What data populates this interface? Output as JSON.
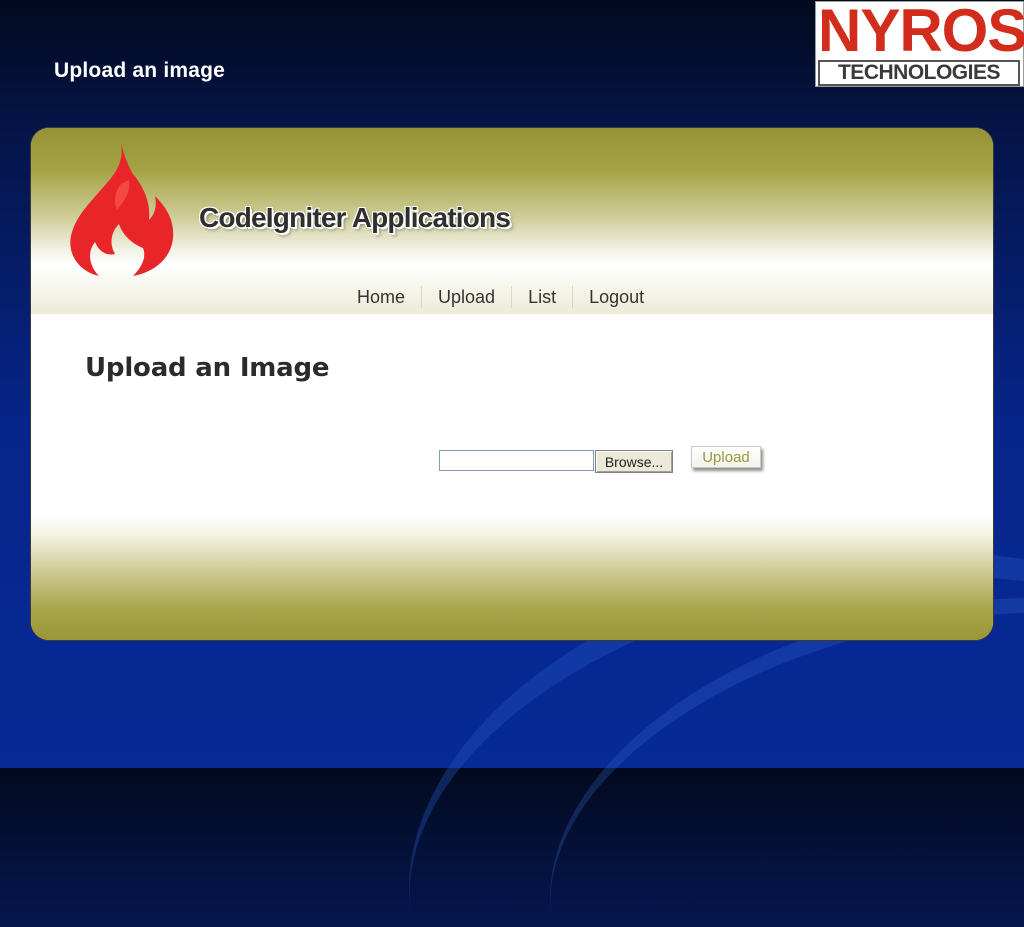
{
  "slide": {
    "title": "Upload an image"
  },
  "logo": {
    "main": "NYROS",
    "sub": "TECHNOLOGIES"
  },
  "app": {
    "name": "CodeIgniter Applications",
    "nav": [
      "Home",
      "Upload",
      "List",
      "Logout"
    ],
    "page_heading": "Upload an Image",
    "file_input_value": "",
    "browse_label": "Browse...",
    "upload_label": "Upload"
  },
  "colors": {
    "brand_red": "#d22d1c",
    "header_olive": "#969336",
    "background_blue": "#06258a"
  },
  "icons": {
    "app_logo": "flame-icon"
  }
}
